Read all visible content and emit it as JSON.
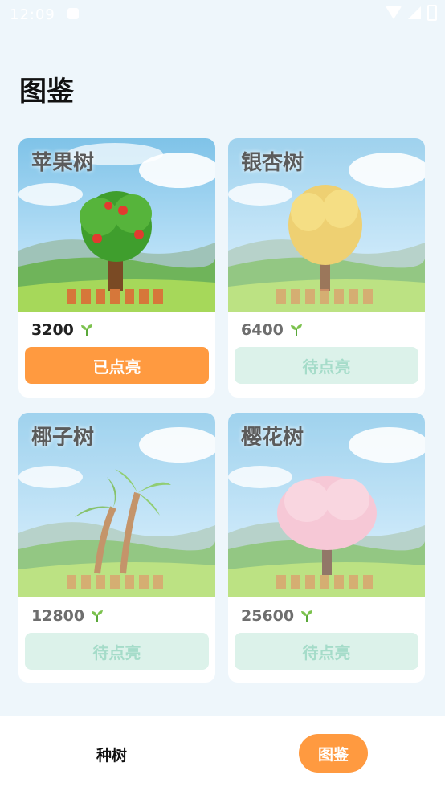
{
  "status": {
    "time": "12:09"
  },
  "page": {
    "title": "图鉴"
  },
  "trees": [
    {
      "name": "苹果树",
      "price": "3200",
      "button": "已点亮",
      "lit": true,
      "kind": "apple"
    },
    {
      "name": "银杏树",
      "price": "6400",
      "button": "待点亮",
      "lit": false,
      "kind": "ginkgo"
    },
    {
      "name": "椰子树",
      "price": "12800",
      "button": "待点亮",
      "lit": false,
      "kind": "coconut"
    },
    {
      "name": "樱花树",
      "price": "25600",
      "button": "待点亮",
      "lit": false,
      "kind": "sakura"
    }
  ],
  "icons": {
    "price": "sprout-icon"
  },
  "colors": {
    "accent": "#ff9a40",
    "pending_bg": "#dcf2ea",
    "pending_text": "#a5dcc9"
  },
  "nav": {
    "plant_label": "种树",
    "guide_label": "图鉴",
    "active": "guide"
  }
}
